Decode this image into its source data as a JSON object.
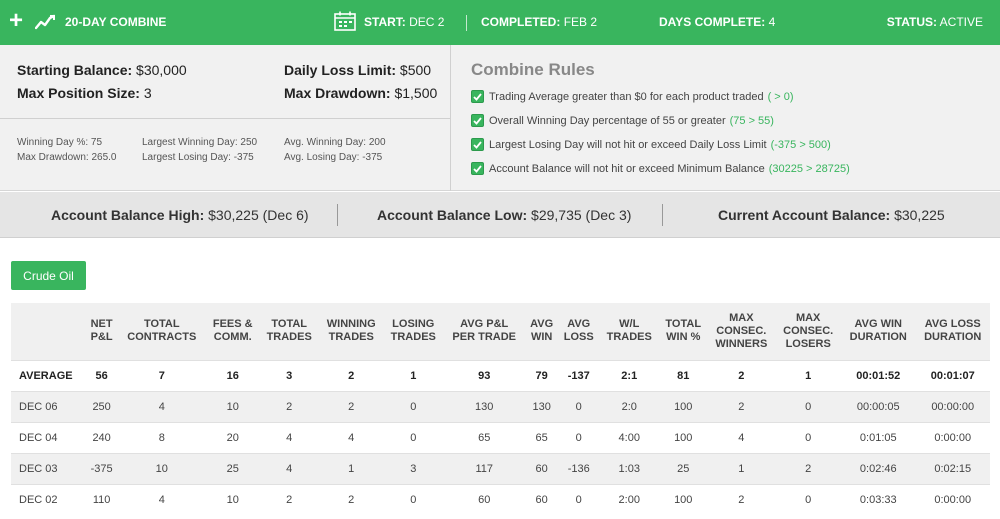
{
  "header": {
    "title": "20-DAY COMBINE",
    "start_label": "START:",
    "start_value": "DEC 2",
    "completed_label": "COMPLETED:",
    "completed_value": "FEB 2",
    "days_label": "DAYS COMPLETE:",
    "days_value": "4",
    "status_label": "STATUS:",
    "status_value": "ACTIVE"
  },
  "summary": {
    "starting_balance_label": "Starting Balance:",
    "starting_balance_value": "$30,000",
    "max_position_label": "Max Position Size:",
    "max_position_value": "3",
    "daily_loss_label": "Daily Loss Limit:",
    "daily_loss_value": "$500",
    "max_drawdown_label": "Max Drawdown:",
    "max_drawdown_value": "$1,500",
    "winning_day_pct": "Winning Day %: 75",
    "max_drawdown_small": "Max Drawdown: 265.0",
    "largest_winning_day": "Largest Winning Day: 250",
    "largest_losing_day": "Largest Losing Day: -375",
    "avg_winning_day": "Avg. Winning Day: 200",
    "avg_losing_day": "Avg. Losing Day: -375"
  },
  "rules": {
    "title": "Combine Rules",
    "items": [
      {
        "text": "Trading Average greater than $0 for each product traded",
        "result": "( > 0)"
      },
      {
        "text": "Overall Winning Day percentage of 55 or greater",
        "result": "(75 > 55)"
      },
      {
        "text": "Largest Losing Day will not hit or exceed Daily Loss Limit",
        "result": "(-375 > 500)"
      },
      {
        "text": "Account Balance will not hit or exceed Minimum Balance",
        "result": "(30225 > 28725)"
      }
    ]
  },
  "balances": {
    "high_label": "Account Balance High:",
    "high_value": "$30,225 (Dec 6)",
    "low_label": "Account Balance Low:",
    "low_value": "$29,735 (Dec 3)",
    "current_label": "Current Account Balance:",
    "current_value": "$30,225"
  },
  "product_button": "Crude Oil",
  "table": {
    "headers": [
      [
        "",
        ""
      ],
      [
        "NET",
        "P&L"
      ],
      [
        "TOTAL",
        "CONTRACTS"
      ],
      [
        "FEES &",
        "COMM."
      ],
      [
        "TOTAL",
        "TRADES"
      ],
      [
        "WINNING",
        "TRADES"
      ],
      [
        "LOSING",
        "TRADES"
      ],
      [
        "AVG P&L",
        "PER TRADE"
      ],
      [
        "AVG",
        "WIN"
      ],
      [
        "AVG",
        "LOSS"
      ],
      [
        "W/L",
        "TRADES"
      ],
      [
        "TOTAL",
        "WIN %"
      ],
      [
        "MAX",
        "CONSEC.",
        "WINNERS"
      ],
      [
        "MAX",
        "CONSEC.",
        "LOSERS"
      ],
      [
        "AVG WIN",
        "DURATION"
      ],
      [
        "AVG LOSS",
        "DURATION"
      ]
    ],
    "rows": [
      [
        "AVERAGE",
        "56",
        "7",
        "16",
        "3",
        "2",
        "1",
        "93",
        "79",
        "-137",
        "2:1",
        "81",
        "2",
        "1",
        "00:01:52",
        "00:01:07"
      ],
      [
        "DEC 06",
        "250",
        "4",
        "10",
        "2",
        "2",
        "0",
        "130",
        "130",
        "0",
        "2:0",
        "100",
        "2",
        "0",
        "00:00:05",
        "00:00:00"
      ],
      [
        "DEC 04",
        "240",
        "8",
        "20",
        "4",
        "4",
        "0",
        "65",
        "65",
        "0",
        "4:00",
        "100",
        "4",
        "0",
        "0:01:05",
        "0:00:00"
      ],
      [
        "DEC 03",
        "-375",
        "10",
        "25",
        "4",
        "1",
        "3",
        "117",
        "60",
        "-136",
        "1:03",
        "25",
        "1",
        "2",
        "0:02:46",
        "0:02:15"
      ],
      [
        "DEC 02",
        "110",
        "4",
        "10",
        "2",
        "2",
        "0",
        "60",
        "60",
        "0",
        "2:00",
        "100",
        "2",
        "0",
        "0:03:33",
        "0:00:00"
      ]
    ]
  },
  "colors": {
    "accent": "#39b55e",
    "panel_bg": "#f1f1f1",
    "balance_bg": "#e5e5e5"
  }
}
